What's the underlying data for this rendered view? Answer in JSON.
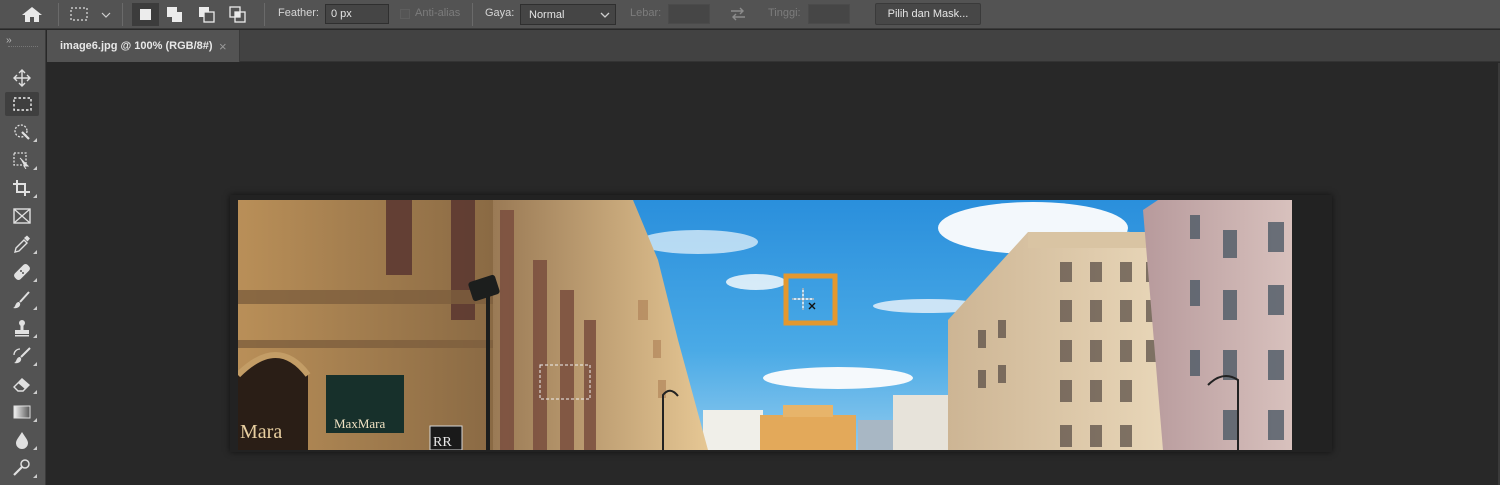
{
  "options_bar": {
    "feather_label": "Feather:",
    "feather_value": "0 px",
    "antialias_label": "Anti-alias",
    "style_label": "Gaya:",
    "style_value": "Normal",
    "width_label": "Lebar:",
    "height_label": "Tinggi:",
    "select_mask_label": "Pilih dan Mask..."
  },
  "document_tab": {
    "title": "image6.jpg @ 100% (RGB/8#)",
    "close_glyph": "×"
  },
  "toolbar": {
    "grip": "››",
    "tools": [
      "move",
      "rectangular-marquee",
      "quick-selection",
      "object-selection",
      "crop",
      "frame",
      "eyedropper",
      "healing-brush",
      "brush",
      "clone-stamp",
      "history-brush",
      "eraser",
      "gradient",
      "blur",
      "dodge"
    ],
    "active_tool": "rectangular-marquee"
  },
  "image": {
    "sign_maxmara": "MaxMara",
    "sign_mara": "Mara",
    "sign_rr": "RR"
  },
  "colors": {
    "highlight": "#e3982f",
    "ui_bg": "#535353",
    "workspace": "#282828"
  }
}
